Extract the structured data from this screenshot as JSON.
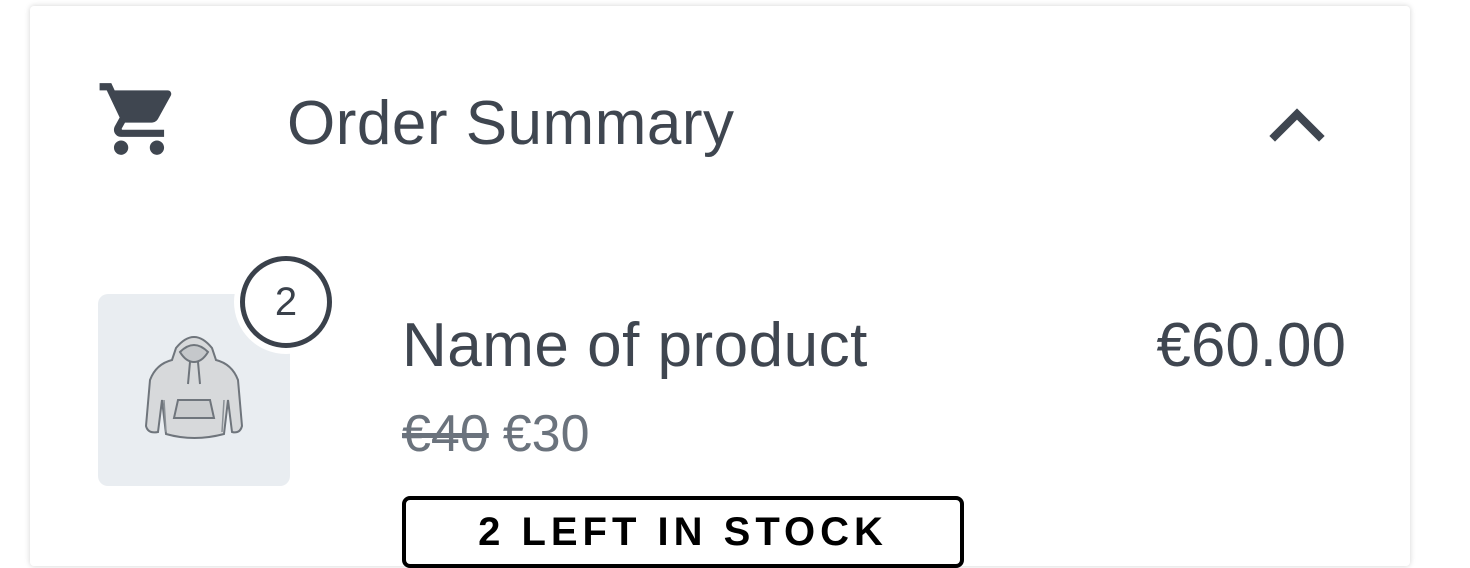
{
  "order_summary": {
    "title": "Order Summary",
    "icons": {
      "cart": "shopping-cart-icon",
      "toggle": "chevron-up-icon"
    }
  },
  "product": {
    "name": "Name of product",
    "quantity": "2",
    "original_price": "€40",
    "sale_price": "€30",
    "line_total": "€60.00",
    "stock_label": "2 LEFT IN STOCK",
    "image": "hoodie-image"
  },
  "colors": {
    "text": "#3f4650",
    "muted_text": "#6b737d",
    "thumb_background": "#e9edf1",
    "badge_border": "#3a414b"
  }
}
